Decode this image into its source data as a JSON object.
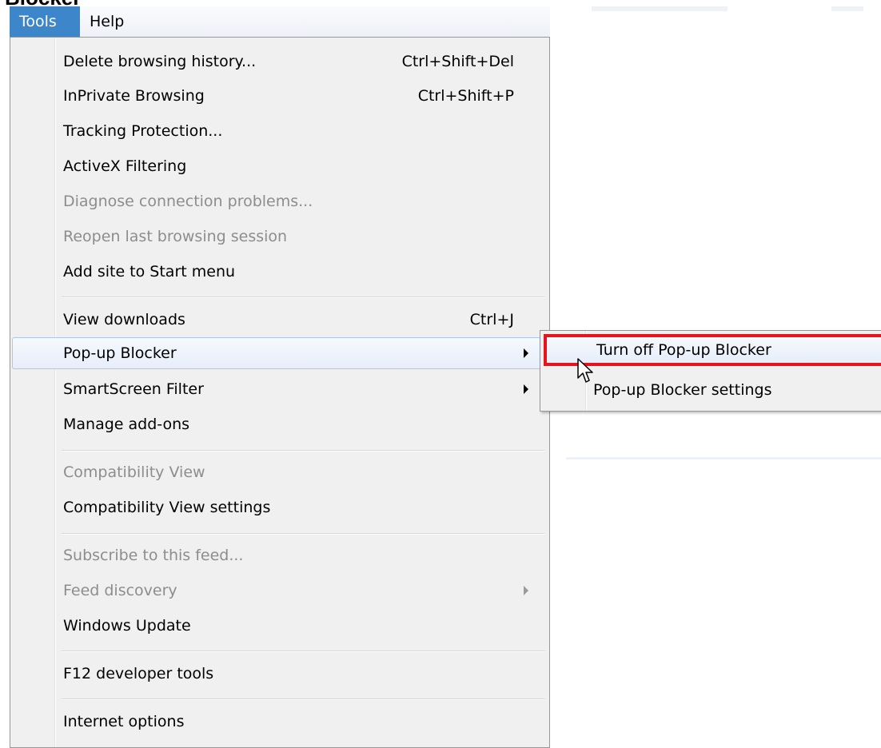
{
  "page_heading": "Blocker",
  "menubar": {
    "items": [
      {
        "label": "Tools",
        "active": true
      },
      {
        "label": "Help",
        "active": false
      }
    ]
  },
  "dropdown": {
    "items": [
      {
        "label": "Delete browsing history...",
        "shortcut": "Ctrl+Shift+Del",
        "disabled": false
      },
      {
        "label": "InPrivate Browsing",
        "shortcut": "Ctrl+Shift+P",
        "disabled": false
      },
      {
        "label": "Tracking Protection...",
        "disabled": false
      },
      {
        "label": "ActiveX Filtering",
        "disabled": false
      },
      {
        "label": "Diagnose connection problems...",
        "disabled": true
      },
      {
        "label": "Reopen last browsing session",
        "disabled": true
      },
      {
        "label": "Add site to Start menu",
        "disabled": false
      },
      {
        "label": "View downloads",
        "shortcut": "Ctrl+J",
        "disabled": false
      },
      {
        "label": "Pop-up Blocker",
        "submenu": true,
        "disabled": false,
        "hover": true
      },
      {
        "label": "SmartScreen Filter",
        "submenu": true,
        "disabled": false
      },
      {
        "label": "Manage add-ons",
        "disabled": false
      },
      {
        "label": "Compatibility View",
        "disabled": true
      },
      {
        "label": "Compatibility View settings",
        "disabled": false
      },
      {
        "label": "Subscribe to this feed...",
        "disabled": true
      },
      {
        "label": "Feed discovery",
        "submenu": true,
        "disabled": true
      },
      {
        "label": "Windows Update",
        "disabled": false
      },
      {
        "label": "F12 developer tools",
        "disabled": false
      },
      {
        "label": "Internet options",
        "disabled": false
      }
    ]
  },
  "submenu": {
    "items": [
      {
        "label": "Turn off Pop-up Blocker",
        "highlighted": true
      },
      {
        "label": "Pop-up Blocker settings",
        "highlighted": false
      }
    ]
  },
  "colors": {
    "active_menu": "#3d86c9",
    "highlight_border": "#e8141c",
    "disabled_text": "#8d8d8d",
    "menu_background": "#f0f0f0"
  }
}
